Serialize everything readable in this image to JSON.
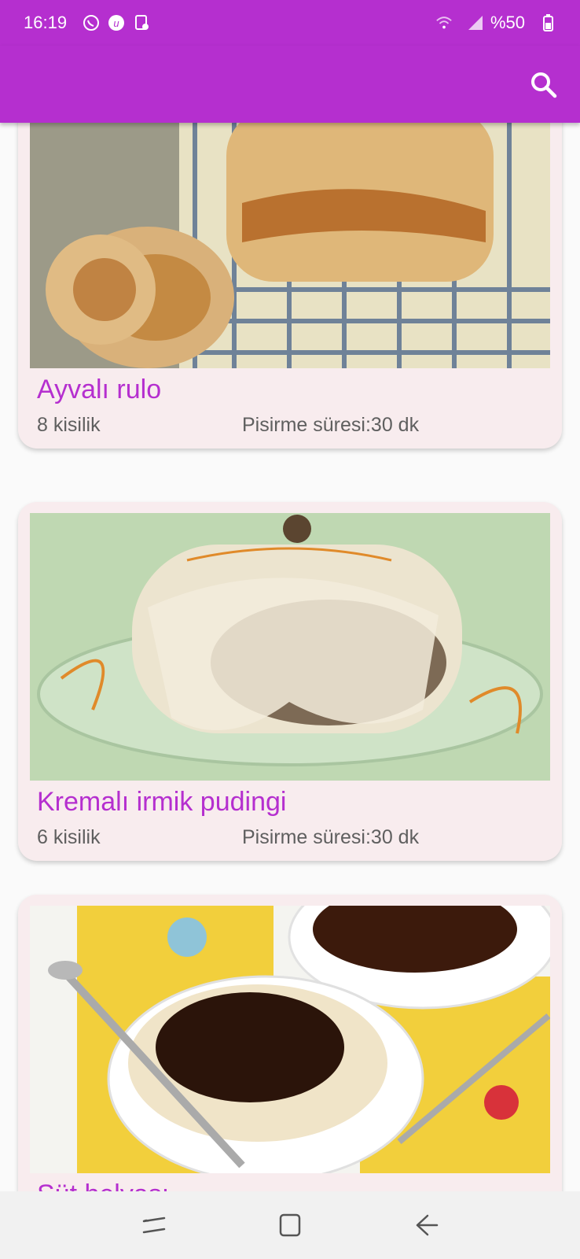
{
  "status_bar": {
    "time": "16:19",
    "battery_text": "%50",
    "icons": [
      "whatsapp-icon",
      "notification-u-icon",
      "screen-icon",
      "wifi-icon",
      "signal-icon",
      "battery-icon"
    ]
  },
  "app_bar": {
    "color": "#b52fcf",
    "search_icon": "search-icon"
  },
  "recipes": [
    {
      "title": "Ayvalı rulo",
      "servings": "8 kisilik",
      "time": "Pisirme süresi:30 dk",
      "image": "quince-roll-photo"
    },
    {
      "title": "Kremalı irmik pudingi",
      "servings": "6 kisilik",
      "time": "Pisirme süresi:30 dk",
      "image": "semolina-pudding-photo"
    },
    {
      "title": "Süt helvası",
      "servings": "",
      "time": "",
      "image": "milk-halva-photo"
    }
  ],
  "nav_bar": {
    "icons": [
      "recent-apps-icon",
      "home-icon",
      "back-icon"
    ]
  }
}
